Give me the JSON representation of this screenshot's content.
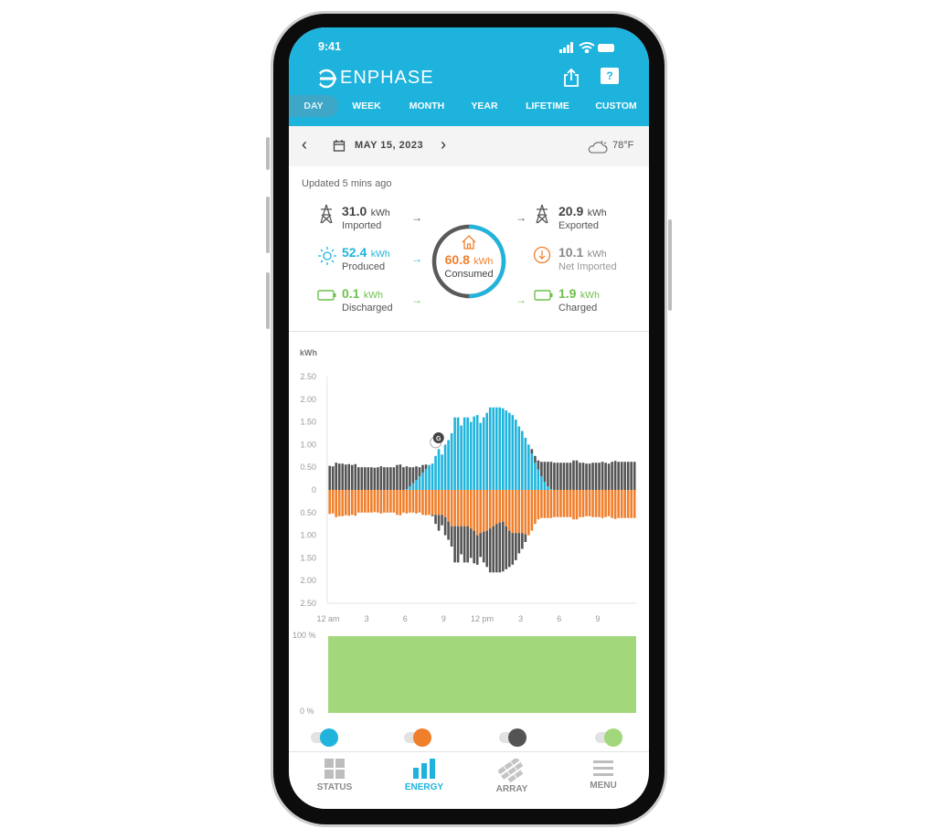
{
  "status_bar": {
    "time": "9:41"
  },
  "header": {
    "brand": "ENPHASE",
    "share_icon": "share-icon",
    "help_icon": "help-icon",
    "help_glyph": "?"
  },
  "tabs": [
    {
      "label": "DAY",
      "active": true
    },
    {
      "label": "WEEK"
    },
    {
      "label": "MONTH"
    },
    {
      "label": "YEAR"
    },
    {
      "label": "LIFETIME"
    },
    {
      "label": "CUSTOM"
    }
  ],
  "date_nav": {
    "date": "MAY 15, 2023",
    "weather": "78°F"
  },
  "summary": {
    "updated": "Updated 5 mins ago",
    "imported": {
      "value": "31.0",
      "unit": "kWh",
      "label": "Imported"
    },
    "produced": {
      "value": "52.4",
      "unit": "kWh",
      "label": "Produced"
    },
    "discharged": {
      "value": "0.1",
      "unit": "kWh",
      "label": "Discharged"
    },
    "consumed": {
      "value": "60.8",
      "unit": "kWh",
      "label": "Consumed"
    },
    "exported": {
      "value": "20.9",
      "unit": "kWh",
      "label": "Exported"
    },
    "net_imported": {
      "value": "10.1",
      "unit": "kWh",
      "label": "Net Imported"
    },
    "charged": {
      "value": "1.9",
      "unit": "kWh",
      "label": "Charged"
    }
  },
  "colors": {
    "brand": "#1db3dc",
    "produced": "#20b4dc",
    "consumed": "#f07f2c",
    "grid": "#545454",
    "battery": "#a3d77c"
  },
  "chart_data": [
    {
      "type": "bar",
      "ylabel": "kWh",
      "ylim": [
        -2.5,
        2.5
      ],
      "y_ticks": [
        "2.50",
        "2.00",
        "1.50",
        "1.00",
        "0.50",
        "0",
        "0.50",
        "1.00",
        "1.50",
        "2.00",
        "2.50"
      ],
      "x_ticks": [
        "12 am",
        "3",
        "6",
        "9",
        "12 pm",
        "3",
        "6",
        "9"
      ],
      "marker_label": "G",
      "interval_minutes": 15,
      "produced": [
        0,
        0,
        0,
        0,
        0,
        0,
        0,
        0,
        0,
        0,
        0,
        0,
        0,
        0,
        0,
        0,
        0,
        0,
        0,
        0,
        0,
        0,
        0,
        0,
        0.02,
        0.08,
        0.15,
        0.22,
        0.3,
        0.38,
        0.46,
        0.55,
        0.58,
        0.75,
        0.9,
        0.78,
        1.0,
        1.1,
        1.25,
        1.6,
        1.6,
        1.42,
        1.6,
        1.6,
        1.5,
        1.62,
        1.65,
        1.48,
        1.6,
        1.7,
        1.82,
        1.82,
        1.82,
        1.82,
        1.8,
        1.75,
        1.7,
        1.65,
        1.55,
        1.4,
        1.3,
        1.15,
        1.0,
        0.8,
        0.6,
        0.45,
        0.3,
        0.18,
        0.08,
        0.02,
        0,
        0,
        0,
        0,
        0,
        0,
        0,
        0,
        0,
        0,
        0,
        0,
        0,
        0,
        0,
        0,
        0,
        0,
        0,
        0,
        0,
        0,
        0,
        0,
        0,
        0
      ],
      "consumed": [
        0.53,
        0.52,
        0.6,
        0.58,
        0.58,
        0.56,
        0.57,
        0.55,
        0.57,
        0.5,
        0.5,
        0.5,
        0.5,
        0.5,
        0.49,
        0.5,
        0.52,
        0.5,
        0.5,
        0.5,
        0.5,
        0.55,
        0.56,
        0.5,
        0.52,
        0.5,
        0.5,
        0.52,
        0.5,
        0.55,
        0.56,
        0.55,
        0.55,
        0.55,
        0.55,
        0.55,
        0.6,
        0.7,
        0.8,
        0.8,
        0.8,
        0.8,
        0.8,
        0.8,
        0.85,
        0.9,
        1.0,
        0.95,
        0.92,
        0.9,
        0.85,
        0.8,
        0.75,
        0.72,
        0.7,
        0.8,
        0.9,
        0.95,
        0.95,
        0.95,
        0.95,
        0.98,
        1.0,
        0.9,
        0.75,
        0.65,
        0.62,
        0.62,
        0.62,
        0.62,
        0.6,
        0.6,
        0.6,
        0.6,
        0.6,
        0.6,
        0.65,
        0.65,
        0.6,
        0.6,
        0.58,
        0.58,
        0.6,
        0.6,
        0.6,
        0.62,
        0.6,
        0.58,
        0.62,
        0.64,
        0.62,
        0.62,
        0.62,
        0.62,
        0.62,
        0.62
      ]
    },
    {
      "type": "area",
      "y_ticks": [
        "100 %",
        "0 %"
      ],
      "ylim": [
        0,
        100
      ],
      "battery_percent": 100
    }
  ],
  "toggles": [
    {
      "series": "produced",
      "on": true
    },
    {
      "series": "consumed",
      "on": true
    },
    {
      "series": "grid",
      "on": true
    },
    {
      "series": "battery",
      "on": true
    }
  ],
  "bottom_nav": [
    {
      "label": "STATUS"
    },
    {
      "label": "ENERGY",
      "active": true
    },
    {
      "label": "ARRAY"
    },
    {
      "label": "MENU"
    }
  ]
}
